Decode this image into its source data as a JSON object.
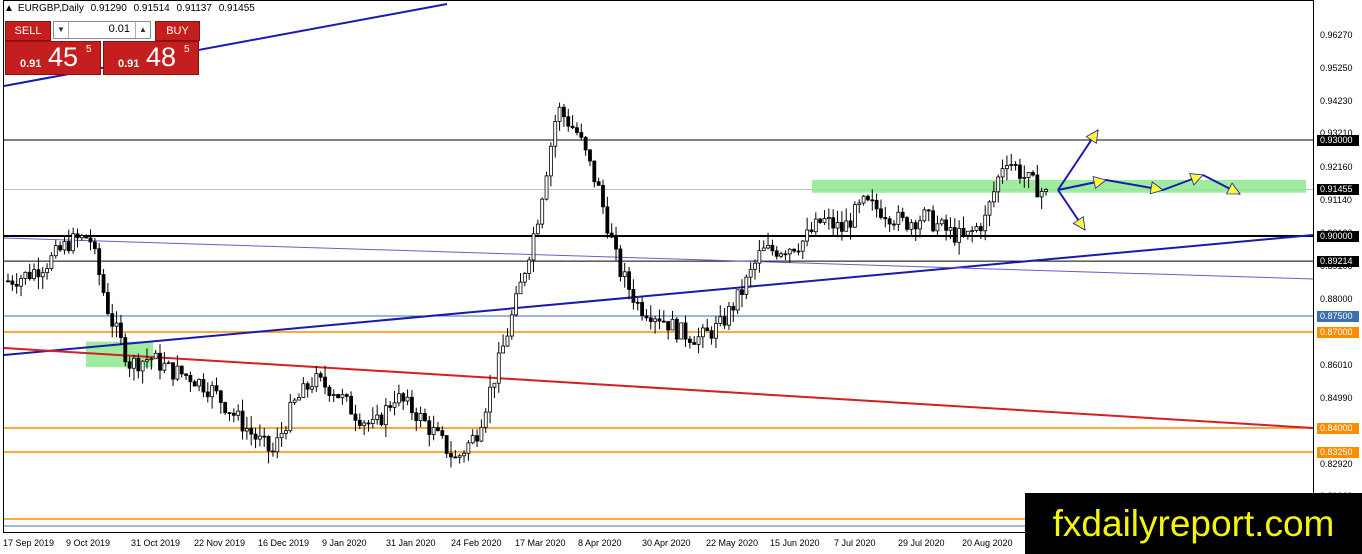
{
  "symbol": {
    "name": "EURGBP,Daily",
    "open": "0.91290",
    "high": "0.91514",
    "low": "0.91137",
    "close": "0.91455"
  },
  "trade_panel": {
    "sell_label": "SELL",
    "buy_label": "BUY",
    "lot_value": "0.01",
    "sell_price_prefix": "0.91",
    "sell_price_big": "45",
    "sell_price_sup": "5",
    "buy_price_prefix": "0.91",
    "buy_price_big": "48",
    "buy_price_sup": "5",
    "color": "#c41e1e"
  },
  "price_axis": {
    "ticks": [
      "0.96270",
      "0.95250",
      "0.94230",
      "0.93210",
      "0.92160",
      "0.91140",
      "0.90120",
      "0.89100",
      "0.88000",
      "0.87050",
      "0.86010",
      "0.84990",
      "0.83970",
      "0.82920",
      "0.81000"
    ],
    "badges": [
      {
        "label": "0.93000",
        "bg": "#000000",
        "fg": "#ffffff"
      },
      {
        "label": "0.91455",
        "bg": "#000000",
        "fg": "#ffffff"
      },
      {
        "label": "0.90000",
        "bg": "#000000",
        "fg": "#ffffff"
      },
      {
        "label": "0.89214",
        "bg": "#000000",
        "fg": "#ffffff"
      },
      {
        "label": "0.87500",
        "bg": "#3b6fb0",
        "fg": "#ffffff"
      },
      {
        "label": "0.87000",
        "bg": "#ff8c00",
        "fg": "#ffffff"
      },
      {
        "label": "0.84000",
        "bg": "#ff8c00",
        "fg": "#ffffff"
      },
      {
        "label": "0.83250",
        "bg": "#ff8c00",
        "fg": "#ffffff"
      }
    ]
  },
  "time_axis": {
    "ticks": [
      "17 Sep 2019",
      "9 Oct 2019",
      "31 Oct 2019",
      "22 Nov 2019",
      "16 Dec 2019",
      "9 Jan 2020",
      "31 Jan 2020",
      "24 Feb 2020",
      "17 Mar 2020",
      "8 Apr 2020",
      "30 Apr 2020",
      "22 May 2020",
      "15 Jun 2020",
      "7 Jul 2020",
      "29 Jul 2020",
      "20 Aug 2020"
    ]
  },
  "watermark": {
    "text": "fxdailyreport.com",
    "bg": "#000000",
    "fg": "#f5f50a"
  },
  "chart_data": {
    "type": "candlestick",
    "symbol": "EURGBP",
    "timeframe": "Daily",
    "ylim": [
      0.8155,
      0.971
    ],
    "x": [
      "17 Sep 2019",
      "9 Oct 2019",
      "31 Oct 2019",
      "22 Nov 2019",
      "16 Dec 2019",
      "9 Jan 2020",
      "31 Jan 2020",
      "24 Feb 2020",
      "17 Mar 2020",
      "8 Apr 2020",
      "30 Apr 2020",
      "22 May 2020",
      "15 Jun 2020",
      "7 Jul 2020",
      "29 Jul 2020",
      "20 Aug 2020"
    ],
    "close_path": [
      0.886,
      0.888,
      0.892,
      0.898,
      0.9,
      0.875,
      0.86,
      0.862,
      0.858,
      0.856,
      0.852,
      0.845,
      0.838,
      0.832,
      0.847,
      0.855,
      0.852,
      0.845,
      0.84,
      0.85,
      0.845,
      0.838,
      0.83,
      0.838,
      0.858,
      0.88,
      0.905,
      0.94,
      0.932,
      0.915,
      0.89,
      0.878,
      0.875,
      0.87,
      0.868,
      0.872,
      0.882,
      0.895,
      0.896,
      0.898,
      0.905,
      0.902,
      0.91,
      0.908,
      0.904,
      0.906,
      0.902,
      0.899,
      0.905,
      0.925,
      0.918,
      0.913
    ],
    "horizontal_levels": [
      {
        "price": 0.93,
        "color": "#000000"
      },
      {
        "price": 0.91455,
        "color": "#c0c0c0"
      },
      {
        "price": 0.9,
        "color": "#000000"
      },
      {
        "price": 0.89214,
        "color": "#000000"
      },
      {
        "price": 0.875,
        "color": "#3b6fb0"
      },
      {
        "price": 0.87,
        "color": "#ff8c00"
      },
      {
        "price": 0.84,
        "color": "#ff8c00"
      },
      {
        "price": 0.8325,
        "color": "#ff8c00"
      }
    ],
    "zones": [
      {
        "from": "9 Oct 2019",
        "to": "31 Oct 2019",
        "low": 0.859,
        "high": 0.867,
        "color": "#8ee88e"
      },
      {
        "from": "7 Jul 2020",
        "to": "20 Aug 2020",
        "low": 0.9135,
        "high": 0.9175,
        "color": "#8ee88e"
      }
    ],
    "trendlines": [
      {
        "color": "#1a1ab0"
      },
      {
        "color": "#1a1ab0"
      },
      {
        "color": "#6a5acd"
      },
      {
        "color": "#d42020"
      }
    ],
    "projection_arrows": {
      "color": "#ffff33",
      "outline": "#1a1ab0"
    }
  }
}
